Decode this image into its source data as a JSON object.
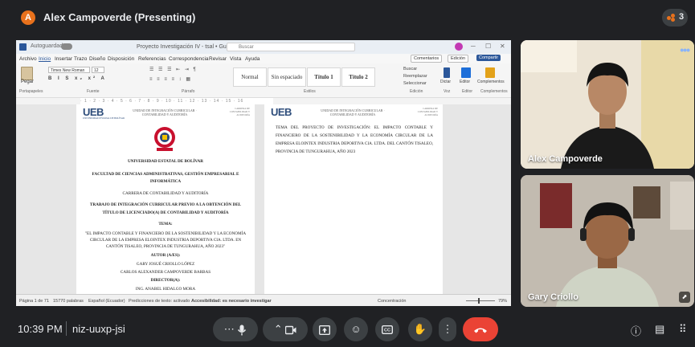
{
  "header": {
    "presenter_initial": "A",
    "presenter_label": "Alex Campoverde (Presenting)",
    "participant_count": "3"
  },
  "word": {
    "autosave_label": "Autoguardado",
    "doc_title": "Proyecto Investigación IV - tsal • Guardado ✓",
    "search_placeholder": "Buscar",
    "menu": [
      "Archivo",
      "Inicio",
      "Insertar",
      "Trazo",
      "Diseño",
      "Disposición",
      "Referencias",
      "Correspondencia",
      "Revisar",
      "Vista",
      "Ayuda"
    ],
    "active_menu": "Inicio",
    "comments_label": "Comentarios",
    "edit_label": "Edición",
    "share_label": "Compartir",
    "paste_label": "Pegar",
    "font_name": "Times New Roman",
    "font_size": "12",
    "styles": [
      "Normal",
      "Sin espaciado",
      "Título 1",
      "Título 2"
    ],
    "find_items": [
      "Buscar",
      "Reemplazar",
      "Seleccionar"
    ],
    "dictate_label": "Dictar",
    "editor_label": "Editor",
    "addins_label": "Complementos",
    "group_labels": [
      "Portapapeles",
      "Fuente",
      "Párrafo",
      "Estilos",
      "Edición",
      "Voz",
      "Editor",
      "Complementos"
    ],
    "ruler_ticks": "· 1 · 2 · 3 · 4 · 5 · 6 · 7 · 8 · 9 · 10 · 11 · 12 · 13 · 14 · 15 · 16",
    "page1": {
      "logo": "UEB",
      "logo_sub": "UNIVERSIDAD ESTATAL DE BOLÍVAR",
      "header_center": "UNIDAD DE INTEGRACIÓN CURRICULAR · CONTABILIDAD Y AUDITORÍA",
      "header_right": "CARRERA DE CONTABILIDAD Y AUDITORÍA",
      "lines": [
        "UNIVERSIDAD ESTATAL DE BOLÍVAR",
        "FACULTAD DE CIENCIAS ADMINISTRATIVAS, GESTIÓN EMPRESARIAL E",
        "INFORMÁTICA",
        "CARRERA DE CONTABILIDAD Y AUDITORÍA",
        "TRABAJO DE INTEGRACIÓN CURRICULAR PREVIO A LA OBTENCIÓN DEL",
        "TÍTULO DE LICENCIADO(A) DE CONTABILIDAD Y AUDITORÍA",
        "TEMA:",
        "\"EL IMPACTO CONTABLE Y FINANCIERO DE LA SOSTENIBILIDAD Y LA ECONOMÍA",
        "CIRCULAR DE LA EMPRESA ELOINTEX INDUSTRIA DEPORTIVA CIA. LTDA. EN",
        "CANTÓN TISALEO, PROVINCIA DE TUNGURAHUA, AÑO 2023\"",
        "AUTOR (A/ES):",
        "GARY JOSUÉ CRIOLLO LÓPEZ",
        "CARLOS ALEXANDER CAMPOVERDE BARBAS",
        "DIRECTOR(A):",
        "ING. ANABEL HIDALGO MORA"
      ]
    },
    "page2": {
      "logo": "UEB",
      "header_center": "UNIDAD DE INTEGRACIÓN CURRICULAR · CONTABILIDAD Y AUDITORÍA",
      "header_right": "CARRERA DE CONTABILIDAD Y AUDITORÍA",
      "text": "TEMA DEL PROYECTO DE INVESTIGACIÓN: EL IMPACTO CONTABLE Y FINANCIERO DE LA SOSTENIBILIDAD Y LA ECONOMÍA CIRCULAR DE LA EMPRESA ELOINTEX INDUSTRIA DEPORTIVA CIA. LTDA. DEL CANTÓN TISALEO, PROVINCIA DE TUNGURAHUA, AÑO 2023"
    },
    "status": {
      "page": "Página 1 de 71",
      "words": "15770 palabras",
      "language": "Español (Ecuador)",
      "predictions": "Predicciones de texto: activado",
      "accessibility": "Accesibilidad: es necesario investigar",
      "focus": "Concentración",
      "zoom": "79%"
    }
  },
  "tiles": [
    {
      "name": "Alex Campoverde"
    },
    {
      "name": "Gary Criollo"
    }
  ],
  "footer": {
    "time": "10:39 PM",
    "meeting_code": "niz-uuxp-jsi"
  },
  "colors": {
    "background": "#202124",
    "control": "#3c4043",
    "end_call": "#ea4335",
    "presenter_avatar": "#e8711c",
    "word_blue": "#2b579a"
  }
}
